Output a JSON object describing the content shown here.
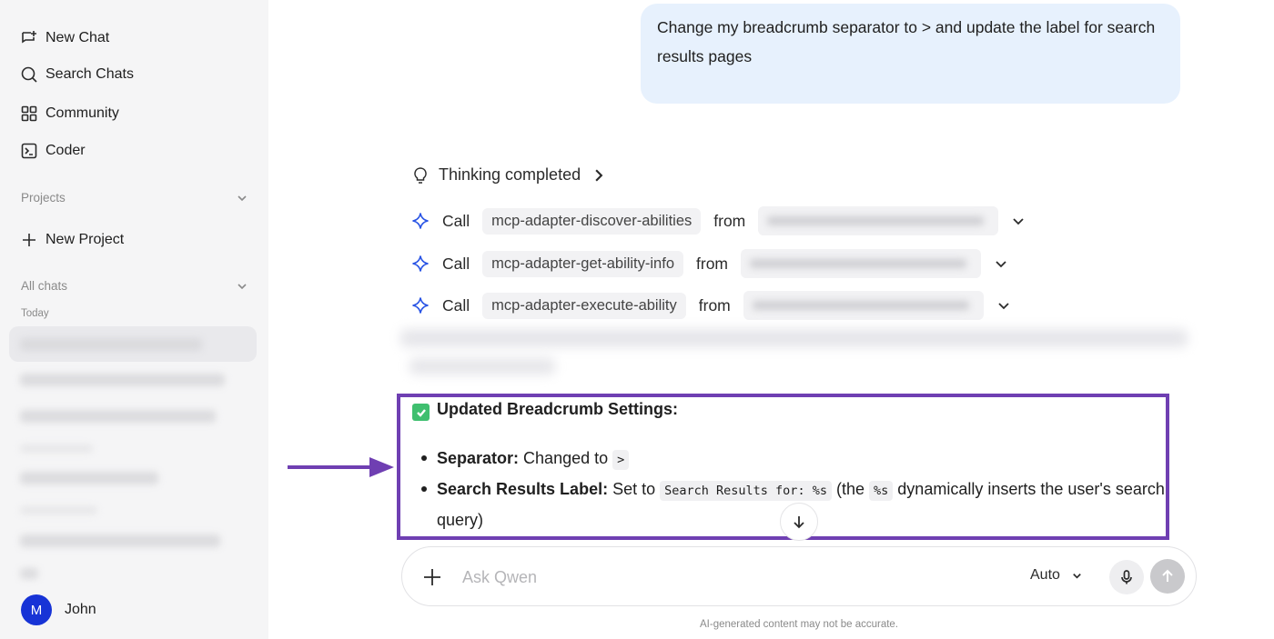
{
  "sidebar": {
    "nav": {
      "new_chat": "New Chat",
      "search_chats": "Search Chats",
      "community": "Community",
      "coder": "Coder"
    },
    "projects_label": "Projects",
    "new_project": "New Project",
    "all_chats_label": "All chats",
    "today_label": "Today",
    "user": {
      "initial": "M",
      "name": "John"
    }
  },
  "conversation": {
    "user_message": "Change my breadcrumb separator to > and update the label for search results pages",
    "thinking": "Thinking completed",
    "tool_calls": [
      {
        "verb": "Call",
        "tool": "mcp-adapter-discover-abilities",
        "from": "from"
      },
      {
        "verb": "Call",
        "tool": "mcp-adapter-get-ability-info",
        "from": "from"
      },
      {
        "verb": "Call",
        "tool": "mcp-adapter-execute-ability",
        "from": "from"
      }
    ],
    "result": {
      "title": "Updated Breadcrumb Settings:",
      "separator_label": "Separator:",
      "separator_text": "Changed to",
      "separator_value": ">",
      "search_label": "Search Results Label:",
      "search_text": "Set to",
      "search_value": "Search Results for: %s",
      "search_note_open": "(the",
      "search_note_code": "%s",
      "search_note_rest": "dynamically inserts the user's search query)"
    }
  },
  "composer": {
    "placeholder": "Ask Qwen",
    "mode": "Auto",
    "disclaimer": "AI-generated content may not be accurate."
  },
  "colors": {
    "highlight": "#6f3fb2",
    "avatar": "#1733d6",
    "user_bubble": "#e7f1fd",
    "check": "#3fbf6f"
  }
}
